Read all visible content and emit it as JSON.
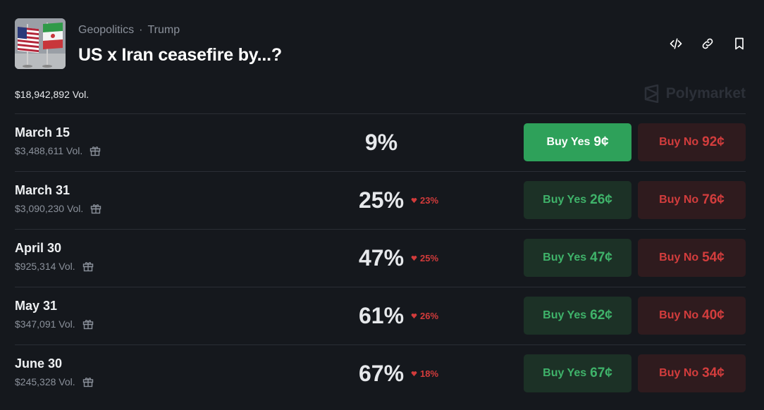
{
  "header": {
    "category": "Geopolitics",
    "separator": "·",
    "subcategory": "Trump",
    "title": "US x Iran ceasefire by...?"
  },
  "total_volume": "$18,942,892 Vol.",
  "brand": "Polymarket",
  "rows": [
    {
      "name": "March 15",
      "volume": "$3,488,611 Vol.",
      "percent": "9%",
      "change": "",
      "yes_label": "Buy Yes",
      "yes_price": "9¢",
      "no_label": "Buy No",
      "no_price": "92¢"
    },
    {
      "name": "March 31",
      "volume": "$3,090,230 Vol.",
      "percent": "25%",
      "change": "23%",
      "yes_label": "Buy Yes",
      "yes_price": "26¢",
      "no_label": "Buy No",
      "no_price": "76¢"
    },
    {
      "name": "April 30",
      "volume": "$925,314 Vol.",
      "percent": "47%",
      "change": "25%",
      "yes_label": "Buy Yes",
      "yes_price": "47¢",
      "no_label": "Buy No",
      "no_price": "54¢"
    },
    {
      "name": "May 31",
      "volume": "$347,091 Vol.",
      "percent": "61%",
      "change": "26%",
      "yes_label": "Buy Yes",
      "yes_price": "62¢",
      "no_label": "Buy No",
      "no_price": "40¢"
    },
    {
      "name": "June 30",
      "volume": "$245,328 Vol.",
      "percent": "67%",
      "change": "18%",
      "yes_label": "Buy Yes",
      "yes_price": "67¢",
      "no_label": "Buy No",
      "no_price": "34¢"
    }
  ],
  "icons": {
    "embed": "code-icon",
    "link": "link-icon",
    "bookmark": "bookmark-icon",
    "gift": "gift-icon",
    "change": "heart-icon"
  },
  "colors": {
    "background": "#15181d",
    "yes_active": "#2ea15a",
    "yes_bg": "#1c3126",
    "yes_text": "#3fb36a",
    "no_bg": "#2f1b1e",
    "no_text": "#d33d3d"
  }
}
